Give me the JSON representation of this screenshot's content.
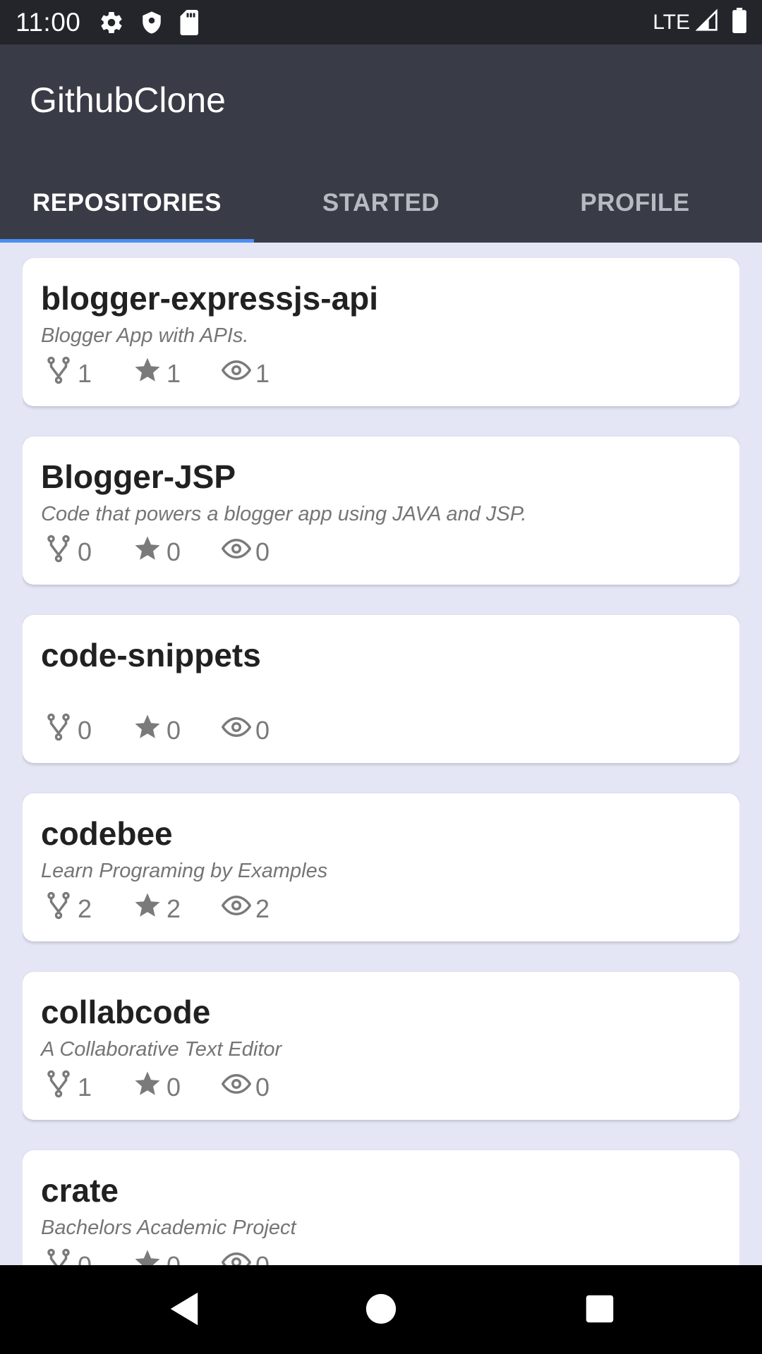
{
  "status_bar": {
    "time": "11:00",
    "network": "LTE"
  },
  "app": {
    "title": "GithubClone"
  },
  "tabs": [
    {
      "label": "REPOSITORIES",
      "active": true
    },
    {
      "label": "STARTED",
      "active": false
    },
    {
      "label": "PROFILE",
      "active": false
    }
  ],
  "colors": {
    "accent": "#4a8ef2",
    "app_bar": "#393c46",
    "background": "#e4e6f6"
  },
  "repos": [
    {
      "name": "blogger-expressjs-api",
      "description": "Blogger App with APIs.",
      "forks": "1",
      "stars": "1",
      "watchers": "1"
    },
    {
      "name": "Blogger-JSP",
      "description": "Code that powers a blogger app using JAVA and JSP.",
      "forks": "0",
      "stars": "0",
      "watchers": "0"
    },
    {
      "name": "code-snippets",
      "description": "",
      "forks": "0",
      "stars": "0",
      "watchers": "0"
    },
    {
      "name": "codebee",
      "description": "Learn Programing by Examples",
      "forks": "2",
      "stars": "2",
      "watchers": "2"
    },
    {
      "name": "collabcode",
      "description": "A Collaborative Text Editor",
      "forks": "1",
      "stars": "0",
      "watchers": "0"
    },
    {
      "name": "crate",
      "description": "Bachelors Academic Project",
      "forks": "0",
      "stars": "0",
      "watchers": "0"
    }
  ]
}
